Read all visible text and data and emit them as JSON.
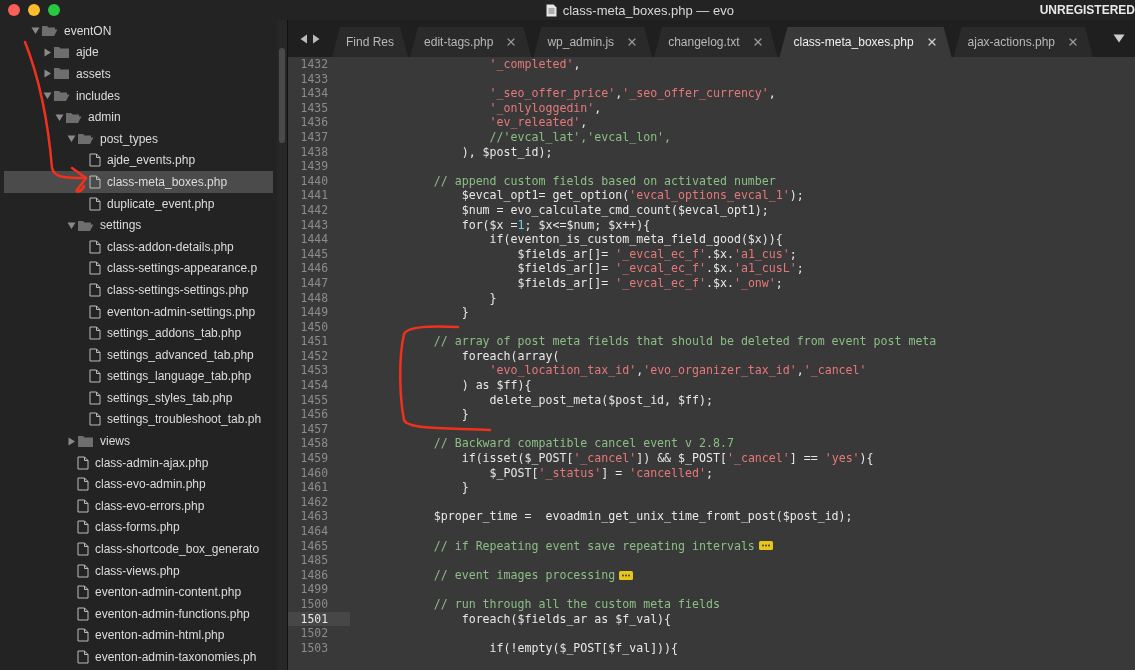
{
  "window": {
    "title": "class-meta_boxes.php — evo",
    "badge": "UNREGISTERED"
  },
  "sidebar": {
    "tree": [
      {
        "label": "eventON",
        "kind": "folder",
        "expanded": true,
        "selected": false,
        "children": [
          {
            "label": "ajde",
            "kind": "folder",
            "expanded": false,
            "selected": false
          },
          {
            "label": "assets",
            "kind": "folder",
            "expanded": false,
            "selected": false
          },
          {
            "label": "includes",
            "kind": "folder",
            "expanded": true,
            "selected": false,
            "children": [
              {
                "label": "admin",
                "kind": "folder",
                "expanded": true,
                "selected": false,
                "children": [
                  {
                    "label": "post_types",
                    "kind": "folder",
                    "expanded": true,
                    "selected": false,
                    "children": [
                      {
                        "label": "ajde_events.php",
                        "kind": "file",
                        "selected": false
                      },
                      {
                        "label": "class-meta_boxes.php",
                        "kind": "file",
                        "selected": true
                      },
                      {
                        "label": "duplicate_event.php",
                        "kind": "file",
                        "selected": false
                      }
                    ]
                  },
                  {
                    "label": "settings",
                    "kind": "folder",
                    "expanded": true,
                    "selected": false,
                    "children": [
                      {
                        "label": "class-addon-details.php",
                        "kind": "file",
                        "selected": false
                      },
                      {
                        "label": "class-settings-appearance.p",
                        "kind": "file",
                        "selected": false
                      },
                      {
                        "label": "class-settings-settings.php",
                        "kind": "file",
                        "selected": false
                      },
                      {
                        "label": "eventon-admin-settings.php",
                        "kind": "file",
                        "selected": false
                      },
                      {
                        "label": "settings_addons_tab.php",
                        "kind": "file",
                        "selected": false
                      },
                      {
                        "label": "settings_advanced_tab.php",
                        "kind": "file",
                        "selected": false
                      },
                      {
                        "label": "settings_language_tab.php",
                        "kind": "file",
                        "selected": false
                      },
                      {
                        "label": "settings_styles_tab.php",
                        "kind": "file",
                        "selected": false
                      },
                      {
                        "label": "settings_troubleshoot_tab.ph",
                        "kind": "file",
                        "selected": false
                      }
                    ]
                  },
                  {
                    "label": "views",
                    "kind": "folder",
                    "expanded": false,
                    "selected": false
                  },
                  {
                    "label": "class-admin-ajax.php",
                    "kind": "file",
                    "selected": false
                  },
                  {
                    "label": "class-evo-admin.php",
                    "kind": "file",
                    "selected": false
                  },
                  {
                    "label": "class-evo-errors.php",
                    "kind": "file",
                    "selected": false
                  },
                  {
                    "label": "class-forms.php",
                    "kind": "file",
                    "selected": false
                  },
                  {
                    "label": "class-shortcode_box_generato",
                    "kind": "file",
                    "selected": false
                  },
                  {
                    "label": "class-views.php",
                    "kind": "file",
                    "selected": false
                  },
                  {
                    "label": "eventon-admin-content.php",
                    "kind": "file",
                    "selected": false
                  },
                  {
                    "label": "eventon-admin-functions.php",
                    "kind": "file",
                    "selected": false
                  },
                  {
                    "label": "eventon-admin-html.php",
                    "kind": "file",
                    "selected": false
                  },
                  {
                    "label": "eventon-admin-taxonomies.ph",
                    "kind": "file",
                    "selected": false
                  }
                ]
              }
            ]
          }
        ]
      }
    ]
  },
  "tabs": [
    {
      "label": "Find Res",
      "selected": false,
      "closable": false
    },
    {
      "label": "edit-tags.php",
      "selected": false,
      "closable": true
    },
    {
      "label": "wp_admin.js",
      "selected": false,
      "closable": true
    },
    {
      "label": "changelog.txt",
      "selected": false,
      "closable": true
    },
    {
      "label": "class-meta_boxes.php",
      "selected": true,
      "closable": true
    },
    {
      "label": "ajax-actions.php",
      "selected": false,
      "closable": true
    }
  ],
  "editor": {
    "lines": [
      {
        "number": "1432",
        "current": false,
        "segments": [
          {
            "kind": "string",
            "text": "                    '_completed'"
          },
          {
            "kind": "plain",
            "text": ","
          }
        ]
      },
      {
        "number": "1433",
        "current": false
      },
      {
        "number": "1434",
        "current": false,
        "segments": [
          {
            "kind": "string",
            "text": "                    '_seo_offer_price'"
          },
          {
            "kind": "plain",
            "text": ","
          },
          {
            "kind": "string",
            "text": "'_seo_offer_currency'"
          },
          {
            "kind": "plain",
            "text": ","
          }
        ]
      },
      {
        "number": "1435",
        "current": false,
        "segments": [
          {
            "kind": "string",
            "text": "                    '_onlyloggedin'"
          },
          {
            "kind": "plain",
            "text": ","
          }
        ]
      },
      {
        "number": "1436",
        "current": false,
        "segments": [
          {
            "kind": "string",
            "text": "                    'ev_releated'"
          },
          {
            "kind": "plain",
            "text": ","
          }
        ]
      },
      {
        "number": "1437",
        "current": false,
        "segments": [
          {
            "kind": "comment",
            "text": "                    //'evcal_lat','evcal_lon',"
          }
        ]
      },
      {
        "number": "1438",
        "current": false,
        "segments": [
          {
            "kind": "plain",
            "text": "                ), $post_id);"
          }
        ]
      },
      {
        "number": "1439",
        "current": false
      },
      {
        "number": "1440",
        "current": false,
        "segments": [
          {
            "kind": "comment",
            "text": "            // append custom fields based on activated number"
          }
        ]
      },
      {
        "number": "1441",
        "current": false,
        "segments": [
          {
            "kind": "plain",
            "text": "                $evcal_opt1= get_option("
          },
          {
            "kind": "string",
            "text": "'evcal_options_evcal_1'"
          },
          {
            "kind": "plain",
            "text": ");"
          }
        ]
      },
      {
        "number": "1442",
        "current": false,
        "segments": [
          {
            "kind": "plain",
            "text": "                $num = evo_calculate_cmd_count($evcal_opt1);"
          }
        ]
      },
      {
        "number": "1443",
        "current": false,
        "segments": [
          {
            "kind": "plain",
            "text": "                for($x ="
          },
          {
            "kind": "number",
            "text": "1"
          },
          {
            "kind": "plain",
            "text": "; $x<=$num; $x++){"
          }
        ]
      },
      {
        "number": "1444",
        "current": false,
        "segments": [
          {
            "kind": "plain",
            "text": "                    if(eventon_is_custom_meta_field_good($x)){"
          }
        ]
      },
      {
        "number": "1445",
        "current": false,
        "segments": [
          {
            "kind": "plain",
            "text": "                        $fields_ar[]= "
          },
          {
            "kind": "string",
            "text": "'_evcal_ec_f'"
          },
          {
            "kind": "plain",
            "text": ".$x."
          },
          {
            "kind": "string",
            "text": "'a1_cus'"
          },
          {
            "kind": "plain",
            "text": ";"
          }
        ]
      },
      {
        "number": "1446",
        "current": false,
        "segments": [
          {
            "kind": "plain",
            "text": "                        $fields_ar[]= "
          },
          {
            "kind": "string",
            "text": "'_evcal_ec_f'"
          },
          {
            "kind": "plain",
            "text": ".$x."
          },
          {
            "kind": "string",
            "text": "'a1_cusL'"
          },
          {
            "kind": "plain",
            "text": ";"
          }
        ]
      },
      {
        "number": "1447",
        "current": false,
        "segments": [
          {
            "kind": "plain",
            "text": "                        $fields_ar[]= "
          },
          {
            "kind": "string",
            "text": "'_evcal_ec_f'"
          },
          {
            "kind": "plain",
            "text": ".$x."
          },
          {
            "kind": "string",
            "text": "'_onw'"
          },
          {
            "kind": "plain",
            "text": ";"
          }
        ]
      },
      {
        "number": "1448",
        "current": false,
        "segments": [
          {
            "kind": "plain",
            "text": "                    }"
          }
        ]
      },
      {
        "number": "1449",
        "current": false,
        "segments": [
          {
            "kind": "plain",
            "text": "                }"
          }
        ]
      },
      {
        "number": "1450",
        "current": false
      },
      {
        "number": "1451",
        "current": false,
        "segments": [
          {
            "kind": "comment",
            "text": "            // array of post meta fields that should be deleted from event post meta"
          }
        ]
      },
      {
        "number": "1452",
        "current": false,
        "segments": [
          {
            "kind": "plain",
            "text": "                foreach(array("
          }
        ]
      },
      {
        "number": "1453",
        "current": false,
        "segments": [
          {
            "kind": "string",
            "text": "                    'evo_location_tax_id'"
          },
          {
            "kind": "plain",
            "text": ","
          },
          {
            "kind": "string",
            "text": "'evo_organizer_tax_id'"
          },
          {
            "kind": "plain",
            "text": ","
          },
          {
            "kind": "string",
            "text": "'_cancel'"
          }
        ]
      },
      {
        "number": "1454",
        "current": false,
        "segments": [
          {
            "kind": "plain",
            "text": "                ) as $ff){"
          }
        ]
      },
      {
        "number": "1455",
        "current": false,
        "segments": [
          {
            "kind": "plain",
            "text": "                    delete_post_meta($post_id, $ff);"
          }
        ]
      },
      {
        "number": "1456",
        "current": false,
        "segments": [
          {
            "kind": "plain",
            "text": "                }"
          }
        ]
      },
      {
        "number": "1457",
        "current": false
      },
      {
        "number": "1458",
        "current": false,
        "segments": [
          {
            "kind": "comment",
            "text": "            // Backward compatible cancel event v 2.8.7"
          }
        ]
      },
      {
        "number": "1459",
        "current": false,
        "segments": [
          {
            "kind": "plain",
            "text": "                if(isset($_POST["
          },
          {
            "kind": "string",
            "text": "'_cancel'"
          },
          {
            "kind": "plain",
            "text": "]) && $_POST["
          },
          {
            "kind": "string",
            "text": "'_cancel'"
          },
          {
            "kind": "plain",
            "text": "] == "
          },
          {
            "kind": "string",
            "text": "'yes'"
          },
          {
            "kind": "plain",
            "text": "){"
          }
        ]
      },
      {
        "number": "1460",
        "current": false,
        "segments": [
          {
            "kind": "plain",
            "text": "                    $_POST["
          },
          {
            "kind": "string",
            "text": "'_status'"
          },
          {
            "kind": "plain",
            "text": "] = "
          },
          {
            "kind": "string",
            "text": "'cancelled'"
          },
          {
            "kind": "plain",
            "text": ";"
          }
        ]
      },
      {
        "number": "1461",
        "current": false,
        "segments": [
          {
            "kind": "plain",
            "text": "                }"
          }
        ]
      },
      {
        "number": "1462",
        "current": false
      },
      {
        "number": "1463",
        "current": false,
        "segments": [
          {
            "kind": "plain",
            "text": "            $proper_time =  evoadmin_get_unix_time_fromt_post($post_id);"
          }
        ]
      },
      {
        "number": "1464",
        "current": false
      },
      {
        "number": "1465",
        "current": false,
        "segments": [
          {
            "kind": "comment",
            "text": "            // if Repeating event save repeating intervals"
          },
          {
            "kind": "fold"
          }
        ]
      },
      {
        "number": "1485",
        "current": false
      },
      {
        "number": "1486",
        "current": false,
        "segments": [
          {
            "kind": "comment",
            "text": "            // event images processing"
          },
          {
            "kind": "fold"
          }
        ]
      },
      {
        "number": "1499",
        "current": false
      },
      {
        "number": "1500",
        "current": false,
        "segments": [
          {
            "kind": "comment",
            "text": "            // run through all the custom meta fields"
          }
        ]
      },
      {
        "number": "1501",
        "current": true,
        "segments": [
          {
            "kind": "plain",
            "text": "                foreach($fields_ar as $f_val){"
          }
        ]
      },
      {
        "number": "1502",
        "current": false
      },
      {
        "number": "1503",
        "current": false,
        "segments": [
          {
            "kind": "plain",
            "text": "                    if(!empty($_POST[$f_val])){"
          }
        ]
      }
    ]
  }
}
